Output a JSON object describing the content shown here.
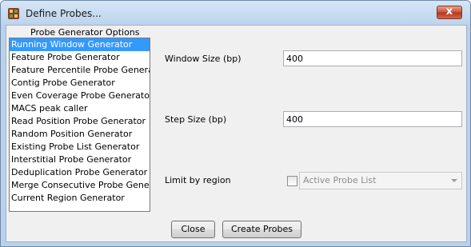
{
  "window": {
    "title": "Define Probes...",
    "close_glyph": "x"
  },
  "list": {
    "title": "Probe Generator Options",
    "items": [
      {
        "label": "Running Window Generator",
        "selected": true
      },
      {
        "label": "Feature Probe Generator",
        "selected": false
      },
      {
        "label": "Feature Percentile Probe Generator",
        "selected": false
      },
      {
        "label": "Contig Probe Generator",
        "selected": false
      },
      {
        "label": "Even Coverage Probe Generator",
        "selected": false
      },
      {
        "label": "MACS peak caller",
        "selected": false
      },
      {
        "label": "Read Position Probe Generator",
        "selected": false
      },
      {
        "label": "Random Position Generator",
        "selected": false
      },
      {
        "label": "Existing Probe List Generator",
        "selected": false
      },
      {
        "label": "Interstitial Probe Generator",
        "selected": false
      },
      {
        "label": "Deduplication Probe Generator",
        "selected": false
      },
      {
        "label": "Merge Consecutive Probe Generator",
        "selected": false
      },
      {
        "label": "Current Region Generator",
        "selected": false
      }
    ]
  },
  "options": {
    "window_size_label": "Window Size (bp)",
    "window_size_value": "400",
    "step_size_label": "Step Size (bp)",
    "step_size_value": "400",
    "limit_label": "Limit by region",
    "limit_checked": false,
    "limit_dropdown_value": "Active Probe List"
  },
  "buttons": {
    "close_label": "Close",
    "create_label": "Create Probes"
  },
  "colors": {
    "selection": "#3399ff",
    "titlebar": "#bcd4ec",
    "panel": "#f0f0f0"
  }
}
